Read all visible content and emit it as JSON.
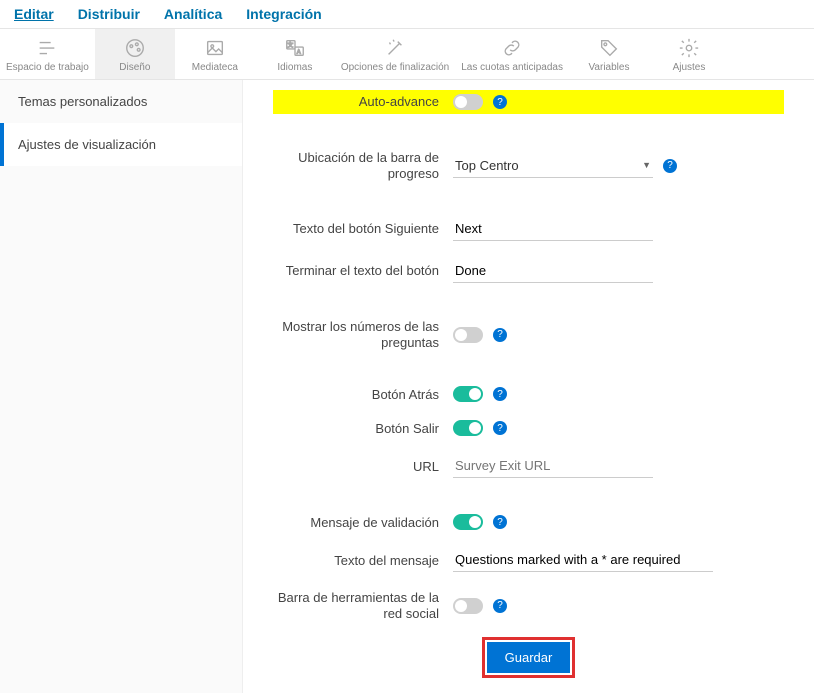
{
  "topTabs": {
    "edit": "Editar",
    "distribute": "Distribuir",
    "analytics": "Analítica",
    "integration": "Integración"
  },
  "toolbar": {
    "workspace": "Espacio de trabajo",
    "design": "Diseño",
    "media": "Mediateca",
    "languages": "Idiomas",
    "completion": "Opciones de finalización",
    "quotas": "Las cuotas anticipadas",
    "variables": "Variables",
    "settings": "Ajustes"
  },
  "sidebar": {
    "themes": "Temas personalizados",
    "display": "Ajustes de visualización"
  },
  "form": {
    "autoAdvance": {
      "label": "Auto-advance",
      "value": false
    },
    "progressBar": {
      "label": "Ubicación de la barra de progreso",
      "value": "Top Centro"
    },
    "nextButton": {
      "label": "Texto del botón Siguiente",
      "value": "Next"
    },
    "doneButton": {
      "label": "Terminar el texto del botón",
      "value": "Done"
    },
    "questionNumbers": {
      "label": "Mostrar los números de las preguntas",
      "value": false
    },
    "backButton": {
      "label": "Botón Atrás",
      "value": true
    },
    "exitButton": {
      "label": "Botón Salir",
      "value": true
    },
    "exitUrl": {
      "label": "URL",
      "placeholder": "Survey Exit URL",
      "value": ""
    },
    "validationMsg": {
      "label": "Mensaje de validación",
      "value": true
    },
    "msgText": {
      "label": "Texto del mensaje",
      "value": "Questions marked with a * are required"
    },
    "socialBar": {
      "label": "Barra de herramientas de la red social",
      "value": false
    }
  },
  "saveButton": "Guardar",
  "helpGlyph": "?"
}
